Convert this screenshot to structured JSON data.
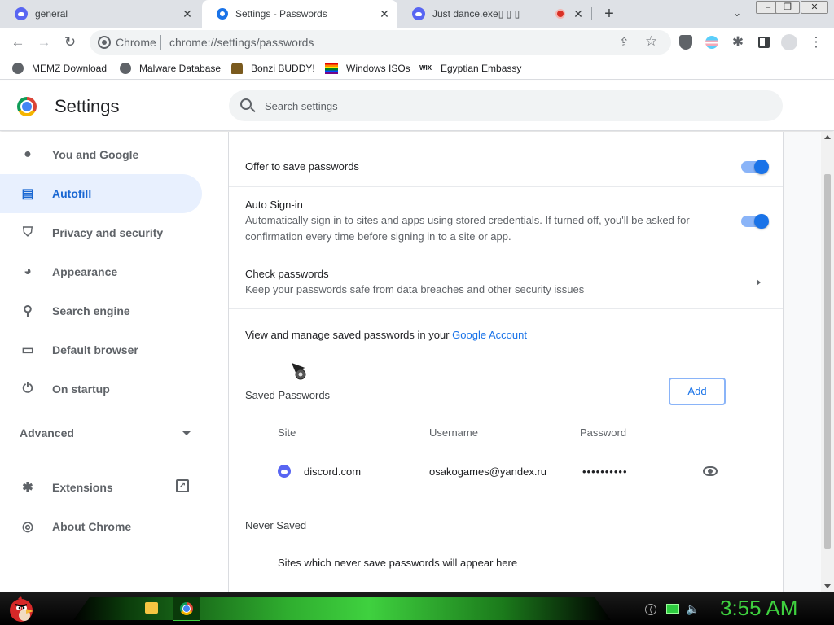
{
  "tabs": [
    {
      "title": "general",
      "icon": "discord-icon"
    },
    {
      "title": "Settings - Passwords",
      "icon": "settings-gear-icon",
      "active": true
    },
    {
      "title": "Just dance.exe▯ ▯ ▯",
      "icon": "discord-icon",
      "recording": true
    }
  ],
  "window_controls": {
    "minimize": "–",
    "restore": "❐",
    "close": "✕"
  },
  "toolbar": {
    "origin_label": "Chrome",
    "url": "chrome://settings/passwords"
  },
  "bookmarks": [
    {
      "label": "MEMZ Download",
      "icon": "globe-icon"
    },
    {
      "label": "Malware Database",
      "icon": "globe-icon"
    },
    {
      "label": "Bonzi BUDDY!",
      "icon": "bonzi-icon"
    },
    {
      "label": "Windows ISOs",
      "icon": "rainbow-flag-icon"
    },
    {
      "label": "Egyptian Embassy",
      "icon": "wix-icon"
    }
  ],
  "settings_header": {
    "title": "Settings",
    "search_placeholder": "Search settings"
  },
  "sidebar": {
    "items": [
      {
        "label": "You and Google",
        "icon": "person-icon"
      },
      {
        "label": "Autofill",
        "icon": "clipboard-icon",
        "active": true
      },
      {
        "label": "Privacy and security",
        "icon": "shield-icon"
      },
      {
        "label": "Appearance",
        "icon": "palette-icon"
      },
      {
        "label": "Search engine",
        "icon": "search-icon"
      },
      {
        "label": "Default browser",
        "icon": "browser-window-icon"
      },
      {
        "label": "On startup",
        "icon": "power-icon"
      }
    ],
    "advanced_label": "Advanced",
    "extensions_label": "Extensions",
    "about_label": "About Chrome"
  },
  "passwords": {
    "offer_to_save": {
      "title": "Offer to save passwords",
      "enabled": true
    },
    "auto_signin": {
      "title": "Auto Sign-in",
      "description": "Automatically sign in to sites and apps using stored credentials. If turned off, you'll be asked for confirmation every time before signing in to a site or app.",
      "enabled": true
    },
    "check_passwords": {
      "title": "Check passwords",
      "description": "Keep your passwords safe from data breaches and other security issues"
    },
    "manage_text": "View and manage saved passwords in your ",
    "manage_link": "Google Account",
    "saved_heading": "Saved Passwords",
    "add_label": "Add",
    "columns": {
      "site": "Site",
      "username": "Username",
      "password": "Password"
    },
    "entries": [
      {
        "site": "discord.com",
        "username": "osakogames@yandex.ru",
        "password_masked": "••••••••••"
      }
    ],
    "never_saved_heading": "Never Saved",
    "never_saved_empty": "Sites which never save passwords will appear here"
  },
  "taskbar": {
    "clock": "3:55 AM"
  },
  "colors": {
    "accent": "#1a73e8",
    "active_nav_bg": "#e8f0fe",
    "taskbar_green": "#3fd13f"
  }
}
